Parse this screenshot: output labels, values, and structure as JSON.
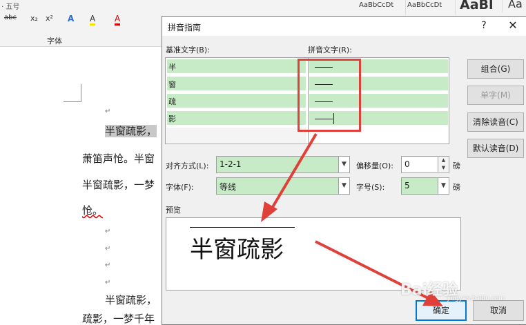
{
  "ribbon": {
    "top_row_left": "· 五号",
    "format_buttons": [
      "abc",
      "x₂",
      "x²",
      "A",
      "A",
      "A"
    ],
    "group_label": "字体",
    "styles": [
      "AaBbCcDt",
      "AaBbCcDt",
      "AaBl",
      "Aa"
    ]
  },
  "document": {
    "lines": [
      {
        "text": "半窗疏影，",
        "highlight": true
      },
      {
        "text": "萧笛声怆。半窗"
      },
      {
        "text": "半窗疏影，一梦"
      },
      {
        "text": "怆。"
      },
      {
        "text": "半窗疏影，"
      },
      {
        "text": "疏影，一梦千年"
      }
    ],
    "para_mark": "↵"
  },
  "dialog": {
    "title": "拼音指南",
    "help": "?",
    "close": "✕",
    "base_text_label": "基准文字(B):",
    "pinyin_label": "拼音文字(R):",
    "rows": [
      {
        "base": "半"
      },
      {
        "base": "窗"
      },
      {
        "base": "疏"
      },
      {
        "base": "影"
      }
    ],
    "buttons": {
      "combine": "组合(G)",
      "single": "单字(M)",
      "clear": "清除读音(C)",
      "default": "默认读音(D)"
    },
    "align_label": "对齐方式(L):",
    "align_value": "1-2-1",
    "offset_label": "偏移量(O):",
    "offset_value": "0",
    "offset_unit": "磅",
    "font_label": "字体(F):",
    "font_value": "等线",
    "size_label": "字号(S):",
    "size_value": "5",
    "size_unit": "磅",
    "preview_label": "预览",
    "preview_text": "半窗疏影",
    "ok": "确定",
    "cancel": "取消"
  },
  "watermark": {
    "text": "Bai经验",
    "sub": "jingyan.baidu.com"
  },
  "colors": {
    "cell_green": "#c6ebc6",
    "annotation_red": "#e0403a",
    "ok_border": "#0078d7"
  }
}
